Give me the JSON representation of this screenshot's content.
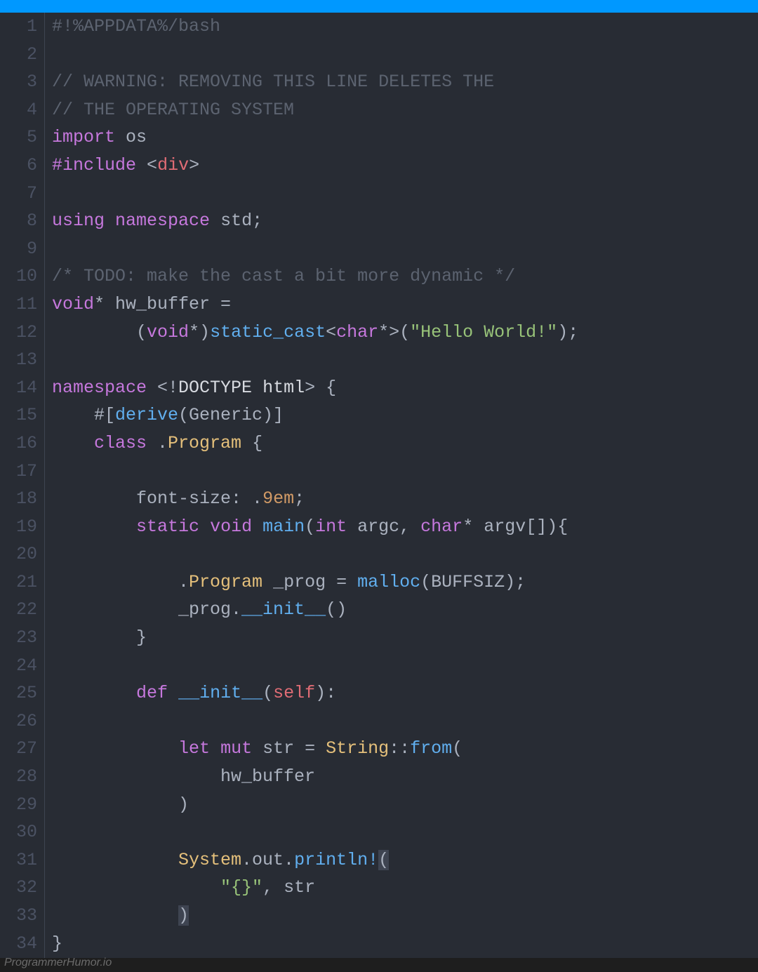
{
  "watermark": "ProgrammerHumor.io",
  "lineNumbers": [
    "1",
    "2",
    "3",
    "4",
    "5",
    "6",
    "7",
    "8",
    "9",
    "10",
    "11",
    "12",
    "13",
    "14",
    "15",
    "16",
    "17",
    "18",
    "19",
    "20",
    "21",
    "22",
    "23",
    "24",
    "25",
    "26",
    "27",
    "28",
    "29",
    "30",
    "31",
    "32",
    "33",
    "34"
  ],
  "code": [
    [
      {
        "t": "#!%APPDATA%/bash",
        "c": "c-comment"
      }
    ],
    [],
    [
      {
        "t": "// WARNING: REMOVING THIS LINE DELETES THE",
        "c": "c-comment"
      }
    ],
    [
      {
        "t": "// THE OPERATING SYSTEM",
        "c": "c-comment"
      }
    ],
    [
      {
        "t": "import",
        "c": "c-keyword"
      },
      {
        "t": " os",
        "c": "c-text"
      }
    ],
    [
      {
        "t": "#include",
        "c": "c-keyword"
      },
      {
        "t": " ",
        "c": "c-text"
      },
      {
        "t": "<",
        "c": "c-text"
      },
      {
        "t": "div",
        "c": "c-tag"
      },
      {
        "t": ">",
        "c": "c-text"
      }
    ],
    [],
    [
      {
        "t": "using",
        "c": "c-keyword"
      },
      {
        "t": " ",
        "c": "c-text"
      },
      {
        "t": "namespace",
        "c": "c-keyword"
      },
      {
        "t": " std",
        "c": "c-text"
      },
      {
        "t": ";",
        "c": "c-text"
      }
    ],
    [],
    [
      {
        "t": "/* TODO: make the cast a bit more dynamic */",
        "c": "c-comment"
      }
    ],
    [
      {
        "t": "void",
        "c": "c-type"
      },
      {
        "t": "* hw_buffer ",
        "c": "c-text"
      },
      {
        "t": "=",
        "c": "c-op"
      }
    ],
    [
      {
        "t": "        (",
        "c": "c-text"
      },
      {
        "t": "void",
        "c": "c-type"
      },
      {
        "t": "*)",
        "c": "c-text"
      },
      {
        "t": "static_cast",
        "c": "c-func"
      },
      {
        "t": "<",
        "c": "c-text"
      },
      {
        "t": "char",
        "c": "c-type"
      },
      {
        "t": "*>(",
        "c": "c-text"
      },
      {
        "t": "\"Hello World!\"",
        "c": "c-str"
      },
      {
        "t": ");",
        "c": "c-text"
      }
    ],
    [],
    [
      {
        "t": "namespace",
        "c": "c-keyword"
      },
      {
        "t": " <!",
        "c": "c-text"
      },
      {
        "t": "DOCTYPE html",
        "c": "c-white"
      },
      {
        "t": "> {",
        "c": "c-text"
      }
    ],
    [
      {
        "t": "    #[",
        "c": "c-text"
      },
      {
        "t": "derive",
        "c": "c-func"
      },
      {
        "t": "(Generic)]",
        "c": "c-text"
      }
    ],
    [
      {
        "t": "    ",
        "c": "c-text"
      },
      {
        "t": "class",
        "c": "c-keyword"
      },
      {
        "t": " .",
        "c": "c-text"
      },
      {
        "t": "Program",
        "c": "c-class"
      },
      {
        "t": " {",
        "c": "c-text"
      }
    ],
    [],
    [
      {
        "t": "        font-size: .",
        "c": "c-text"
      },
      {
        "t": "9em",
        "c": "c-num"
      },
      {
        "t": ";",
        "c": "c-text"
      }
    ],
    [
      {
        "t": "        ",
        "c": "c-text"
      },
      {
        "t": "static",
        "c": "c-keyword"
      },
      {
        "t": " ",
        "c": "c-text"
      },
      {
        "t": "void",
        "c": "c-type"
      },
      {
        "t": " ",
        "c": "c-text"
      },
      {
        "t": "main",
        "c": "c-func"
      },
      {
        "t": "(",
        "c": "c-text"
      },
      {
        "t": "int",
        "c": "c-type"
      },
      {
        "t": " argc, ",
        "c": "c-text"
      },
      {
        "t": "char",
        "c": "c-type"
      },
      {
        "t": "* argv[]){",
        "c": "c-text"
      }
    ],
    [],
    [
      {
        "t": "            .",
        "c": "c-text"
      },
      {
        "t": "Program",
        "c": "c-class"
      },
      {
        "t": " _prog = ",
        "c": "c-text"
      },
      {
        "t": "malloc",
        "c": "c-func"
      },
      {
        "t": "(BUFFSIZ);",
        "c": "c-text"
      }
    ],
    [
      {
        "t": "            _prog.",
        "c": "c-text"
      },
      {
        "t": "__init__",
        "c": "c-func"
      },
      {
        "t": "()",
        "c": "c-text"
      }
    ],
    [
      {
        "t": "        }",
        "c": "c-text"
      }
    ],
    [],
    [
      {
        "t": "        ",
        "c": "c-text"
      },
      {
        "t": "def",
        "c": "c-keyword"
      },
      {
        "t": " ",
        "c": "c-text"
      },
      {
        "t": "__init__",
        "c": "c-func"
      },
      {
        "t": "(",
        "c": "c-text"
      },
      {
        "t": "self",
        "c": "c-self"
      },
      {
        "t": "):",
        "c": "c-text"
      }
    ],
    [],
    [
      {
        "t": "            ",
        "c": "c-text"
      },
      {
        "t": "let",
        "c": "c-keyword"
      },
      {
        "t": " ",
        "c": "c-text"
      },
      {
        "t": "mut",
        "c": "c-keyword"
      },
      {
        "t": " str = ",
        "c": "c-text"
      },
      {
        "t": "String",
        "c": "c-class"
      },
      {
        "t": "::",
        "c": "c-text"
      },
      {
        "t": "from",
        "c": "c-func"
      },
      {
        "t": "(",
        "c": "c-text"
      }
    ],
    [
      {
        "t": "                hw_buffer",
        "c": "c-text"
      }
    ],
    [
      {
        "t": "            )",
        "c": "c-text"
      }
    ],
    [],
    [
      {
        "t": "            ",
        "c": "c-text"
      },
      {
        "t": "System",
        "c": "c-class"
      },
      {
        "t": ".out.",
        "c": "c-text"
      },
      {
        "t": "println!",
        "c": "c-func"
      },
      {
        "t": "(",
        "c": "c-paren-hl"
      }
    ],
    [
      {
        "t": "                ",
        "c": "c-text"
      },
      {
        "t": "\"{}\"",
        "c": "c-str"
      },
      {
        "t": ", str",
        "c": "c-text"
      }
    ],
    [
      {
        "t": "            ",
        "c": "c-text"
      },
      {
        "t": ")",
        "c": "c-paren-hl"
      }
    ],
    [
      {
        "t": "}",
        "c": "c-text"
      }
    ]
  ]
}
